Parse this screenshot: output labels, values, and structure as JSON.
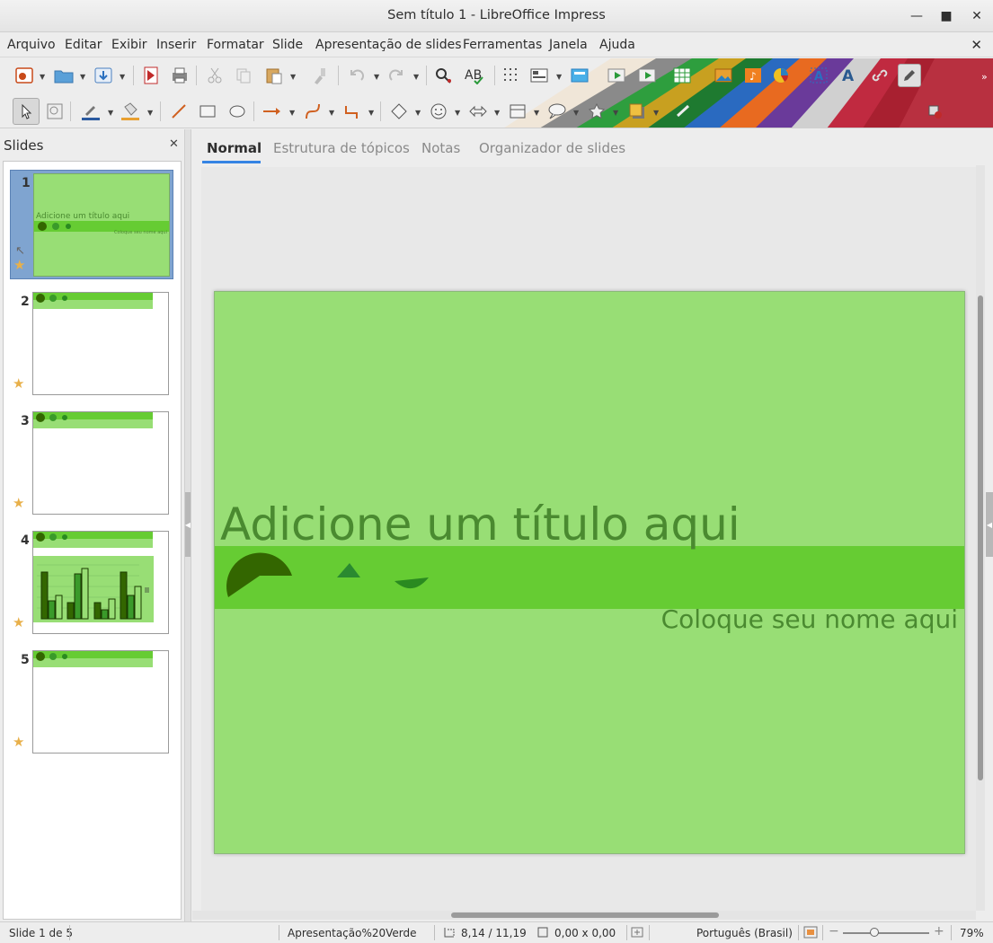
{
  "window": {
    "title": "Sem título 1 - LibreOffice Impress"
  },
  "menu": [
    "Arquivo",
    "Editar",
    "Exibir",
    "Inserir",
    "Formatar",
    "Slide",
    "Apresentação de slides",
    "Ferramentas",
    "Janela",
    "Ajuda"
  ],
  "slides_pane": {
    "title": "Slides",
    "slides": [
      {
        "num": "1",
        "title": "Adicione um título aqui",
        "subtitle": "Coloque seu nome aqui"
      },
      {
        "num": "2"
      },
      {
        "num": "3"
      },
      {
        "num": "4"
      },
      {
        "num": "5"
      }
    ]
  },
  "tabs": [
    "Normal",
    "Estrutura de tópicos",
    "Notas",
    "Organizador de slides"
  ],
  "slide": {
    "title": "Adicione um título aqui",
    "subtitle": "Coloque seu nome aqui"
  },
  "status": {
    "slide": "Slide 1 de 5",
    "master": "Apresentação%20Verde",
    "position": "8,14 / 11,19",
    "size": "0,00 x 0,00",
    "language": "Português (Brasil)",
    "zoom": "79%"
  },
  "colors": {
    "slide_bg": "#98de75",
    "band": "#66cc33",
    "dark_green": "#336600",
    "accent": "#3584e4"
  }
}
